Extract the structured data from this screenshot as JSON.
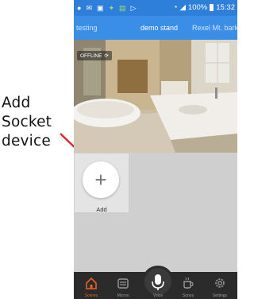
{
  "annotation": {
    "lines": [
      "Add",
      "Socket",
      "device"
    ]
  },
  "status_bar": {
    "battery_text": "100%",
    "time": "15:32"
  },
  "tabs": [
    {
      "label": "testing",
      "active": false
    },
    {
      "label": "demo stand",
      "active": true
    },
    {
      "label": "Rexel Mt. barker",
      "active": false
    }
  ],
  "camera": {
    "badge": "OFFLINE"
  },
  "add_tile": {
    "icon": "plus-icon",
    "label": "Add"
  },
  "bottom_nav": [
    {
      "label": "Scenes",
      "icon": "home-icon",
      "active": true
    },
    {
      "label": "Micros",
      "icon": "device-icon",
      "active": false
    },
    {
      "label": "Voice",
      "icon": "microphone-icon",
      "active": false
    },
    {
      "label": "Sonos",
      "icon": "coffee-icon",
      "active": false
    },
    {
      "label": "Settings",
      "icon": "gear-icon",
      "active": false
    }
  ],
  "colors": {
    "status_bar": "#2e7fd9",
    "tab_bar": "#3b8ee6",
    "nav_bar": "#2b2b2b",
    "accent": "#e5602a",
    "annotation_arrow": "#e0262b"
  }
}
